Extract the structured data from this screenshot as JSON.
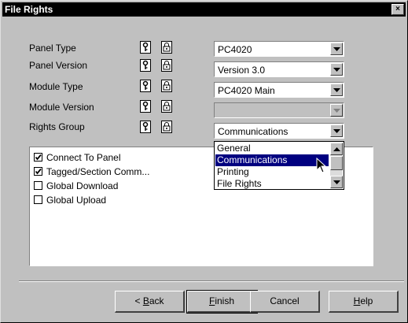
{
  "window": {
    "title": "File Rights",
    "close_glyph": "×"
  },
  "fields": [
    {
      "label": "Panel Type",
      "value": "PC4020",
      "disabled": false
    },
    {
      "label": "Panel Version",
      "value": "Version 3.0",
      "disabled": false
    },
    {
      "label": "Module Type",
      "value": "PC4020 Main",
      "disabled": false
    },
    {
      "label": "Module Version",
      "value": "",
      "disabled": true
    },
    {
      "label": "Rights Group",
      "value": "Communications",
      "disabled": false
    }
  ],
  "icons": {
    "key": "key-icon",
    "lock": "lock-icon"
  },
  "rights_dropdown": {
    "options": [
      "General",
      "Communications",
      "Printing",
      "File Rights"
    ],
    "selected": "Communications"
  },
  "permissions": [
    {
      "label": "Connect To Panel",
      "checked": true
    },
    {
      "label": "Tagged/Section Comm...",
      "checked": true
    },
    {
      "label": "Global Download",
      "checked": false
    },
    {
      "label": "Global Upload",
      "checked": false
    }
  ],
  "buttons": {
    "back": {
      "prefix": "< ",
      "mnemonic": "B",
      "rest": "ack"
    },
    "finish": {
      "mnemonic": "F",
      "rest": "inish"
    },
    "cancel": {
      "label": "Cancel"
    },
    "help": {
      "mnemonic": "H",
      "rest": "elp"
    }
  },
  "colors": {
    "titlebar": "#000000",
    "face": "#c0c0c0",
    "selection": "#000080"
  }
}
